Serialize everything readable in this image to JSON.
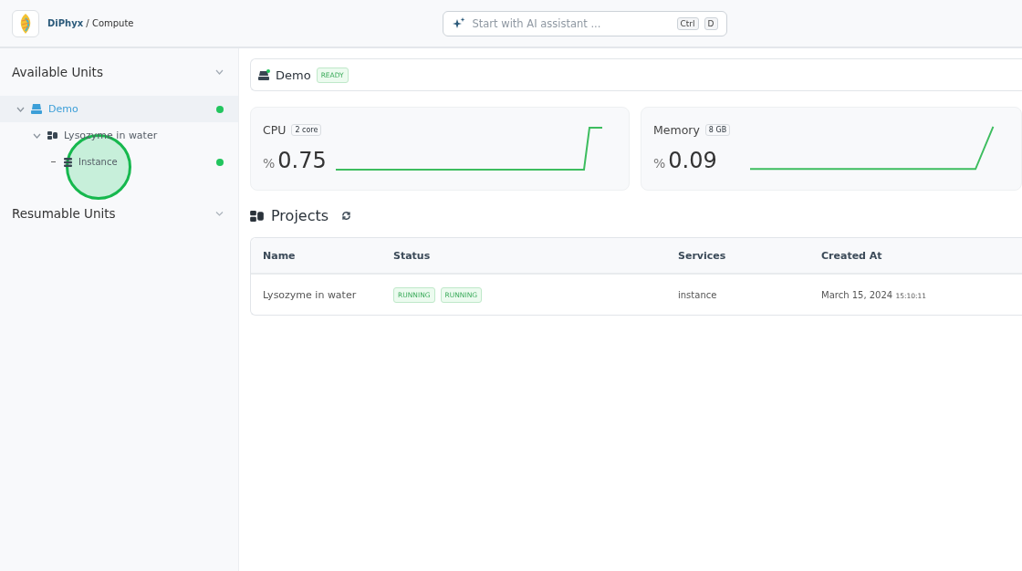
{
  "header": {
    "brand": "DiPhyx",
    "separator": "/",
    "page": "Compute",
    "assistant": {
      "placeholder": "Start with AI assistant ...",
      "keys": [
        "Ctrl",
        "D"
      ]
    }
  },
  "sidebar": {
    "sections": [
      {
        "title": "Available Units",
        "expanded": true,
        "items": [
          {
            "label": "Demo",
            "kind": "unit",
            "selected": true,
            "expanded": true,
            "online": true,
            "children": [
              {
                "label": "Lysozyme in water",
                "kind": "project",
                "selected": false,
                "expanded": true,
                "children": [
                  {
                    "label": "Instance",
                    "kind": "instance",
                    "selected": false,
                    "online": true
                  }
                ]
              }
            ]
          }
        ]
      },
      {
        "title": "Resumable Units",
        "expanded": false
      }
    ]
  },
  "click_indicator": true,
  "unit": {
    "name": "Demo",
    "online": true,
    "status": "READY"
  },
  "metrics": [
    {
      "name": "CPU",
      "badge": "2 core",
      "unit": "%",
      "value": "0.75"
    },
    {
      "name": "Memory",
      "badge": "8 GB",
      "unit": "%",
      "value": "0.09"
    }
  ],
  "projects": {
    "title": "Projects",
    "columns": [
      "Name",
      "Status",
      "Services",
      "Created At"
    ],
    "rows": [
      {
        "name": "Lysozyme in water",
        "status": [
          "RUNNING",
          "RUNNING"
        ],
        "services": "instance",
        "date": "March 15, 2024",
        "time": "15:10:11"
      }
    ]
  }
}
